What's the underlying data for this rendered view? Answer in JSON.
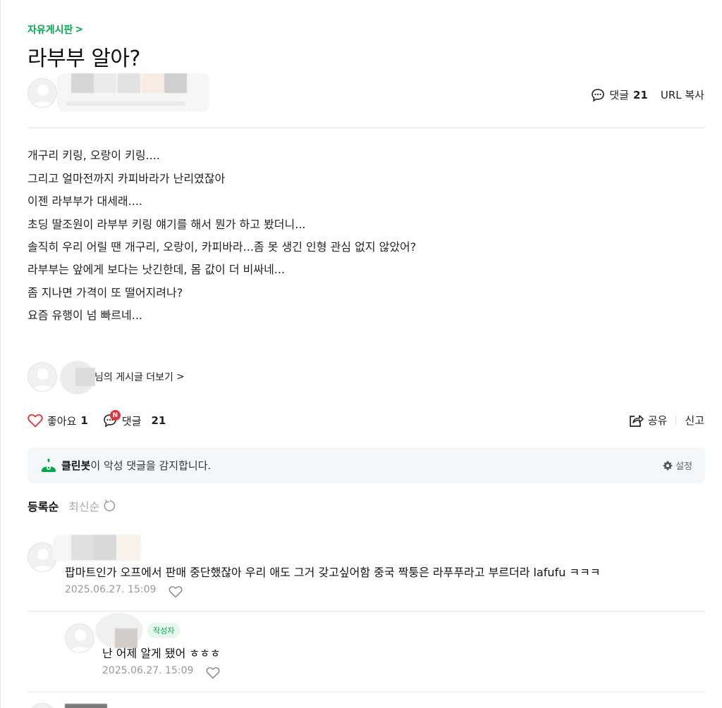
{
  "breadcrumb": {
    "label": "자유게시판",
    "chevron": ">"
  },
  "post": {
    "title": "라부부 알아?",
    "comment_label": "댓글",
    "comment_count": "21",
    "url_copy": "URL 복사",
    "body": [
      "개구리 키링, 오랑이 키링....",
      "그리고 얼마전까지 카피바라가 난리였잖아",
      "이젠 라부부가 대세래....",
      "초딩 딸조원이 라부부 키링 얘기를 해서 뭔가 하고 봤더니...",
      "솔직히 우리 어릴 땐 개구리, 오랑이, 카피바라...좀 못 생긴 인형 관심 없지 않았어?",
      "라부부는 앞에게 보다는 낫긴한데, 몸 값이 더 비싸네...",
      "좀 지나면 가격이 또 떨어지려나?",
      "요즘 유행이 넘 빠르네..."
    ],
    "more_posts": "님의 게시글 더보기",
    "more_posts_chevron": ">"
  },
  "actions": {
    "like_label": "좋아요",
    "like_count": "1",
    "comment_label": "댓글",
    "comment_count": "21",
    "new_badge": "N",
    "share": "공유",
    "report": "신고"
  },
  "cleanbot": {
    "name": "클린봇",
    "message": "이 악성 댓글을 감지합니다.",
    "settings": "설정"
  },
  "sort": {
    "registered": "등록순",
    "latest": "최신순"
  },
  "comments": [
    {
      "text": "팝마트인가 오프에서 판매 중단했잖아 우리 애도 그거 갖고싶어함 중국 짝퉁은 라푸푸라고 부르더라 lafufu ㅋㅋㅋ",
      "date": "2025.06.27. 15:09"
    },
    {
      "badge": "작성자",
      "text": "난 어제 알게 됐어 ㅎㅎㅎ",
      "date": "2025.06.27. 15:09"
    }
  ],
  "colors": {
    "accent": "#03a94d",
    "heart": "#e0323c",
    "badge_red": "#e0323c",
    "panel": "#f5f6f8"
  },
  "icons": [
    "chevron-right-icon",
    "speech-bubble-icon",
    "heart-icon",
    "share-icon",
    "cleanbot-icon",
    "gear-icon",
    "refresh-icon",
    "avatar-placeholder-icon"
  ]
}
